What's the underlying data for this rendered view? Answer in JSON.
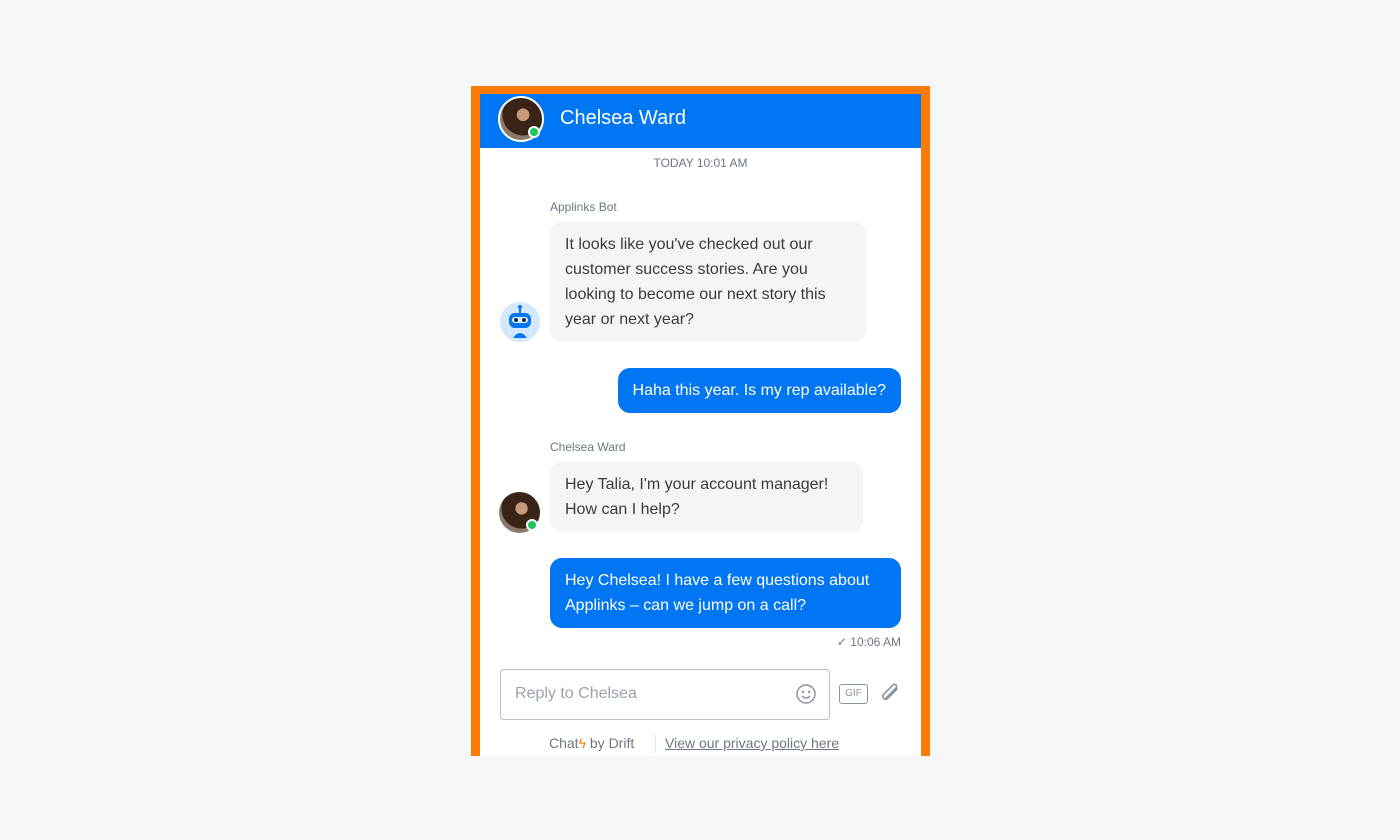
{
  "header": {
    "title": "Chelsea Ward",
    "status": "online"
  },
  "timestamp": "TODAY 10:01 AM",
  "messages": [
    {
      "sender": "Applinks Bot",
      "text": "It looks like you've checked out our customer success stories. Are you looking to become our next story this year or next year?",
      "direction": "incoming"
    },
    {
      "text": "Haha this year. Is my rep available?",
      "direction": "outgoing"
    },
    {
      "sender": "Chelsea Ward",
      "text": "Hey Talia, I'm your account manager! How can I help?",
      "direction": "incoming"
    },
    {
      "text": "Hey Chelsea! I have a few questions about Applinks – can we jump on a call?",
      "direction": "outgoing",
      "time": "10:06 AM"
    }
  ],
  "composer": {
    "placeholder": "Reply to Chelsea",
    "gif_label": "GIF"
  },
  "footer": {
    "chat": "Chat",
    "by": "by Drift",
    "privacy": "View our privacy policy here"
  },
  "colors": {
    "accent": "#0176f3",
    "frame": "#ff7a00",
    "online": "#1ec35c"
  }
}
